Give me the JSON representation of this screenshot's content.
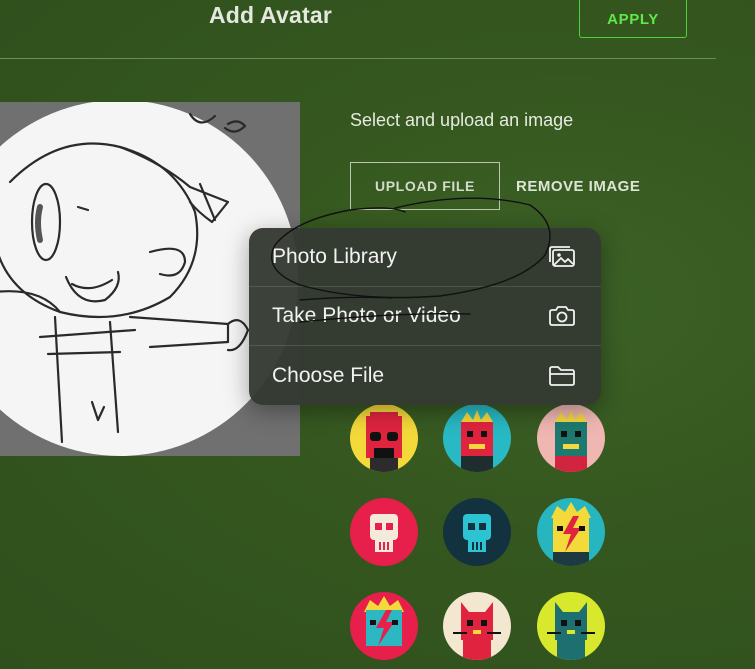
{
  "header": {
    "title": "Add Avatar",
    "apply_label": "APPLY"
  },
  "upload": {
    "instruction": "Select and upload an image",
    "upload_label": "UPLOAD FILE",
    "remove_label": "REMOVE IMAGE"
  },
  "menu": {
    "items": [
      {
        "label": "Photo Library",
        "icon": "photo-library-icon"
      },
      {
        "label": "Take Photo or Video",
        "icon": "camera-icon"
      },
      {
        "label": "Choose File",
        "icon": "folder-icon"
      }
    ]
  },
  "avatars": [
    {
      "name": "avatar-red-hat-glasses",
      "bg": "#f4d93a"
    },
    {
      "name": "avatar-red-crown-teal",
      "bg": "#29b9c4"
    },
    {
      "name": "avatar-teal-crown-pink",
      "bg": "#f0b7b2"
    },
    {
      "name": "avatar-white-skull-red",
      "bg": "#e61f4b"
    },
    {
      "name": "avatar-teal-skull-dark",
      "bg": "#13323f"
    },
    {
      "name": "avatar-bolt-face-teal",
      "bg": "#27b5c0"
    },
    {
      "name": "avatar-bolt-face-red",
      "bg": "#e61f4b"
    },
    {
      "name": "avatar-red-cat-cream",
      "bg": "#f3e7cf"
    },
    {
      "name": "avatar-teal-cat-lime",
      "bg": "#d7e82d"
    }
  ],
  "colors": {
    "accent": "#5ee84a",
    "background": "#35571f",
    "menu_bg": "#343a32"
  }
}
